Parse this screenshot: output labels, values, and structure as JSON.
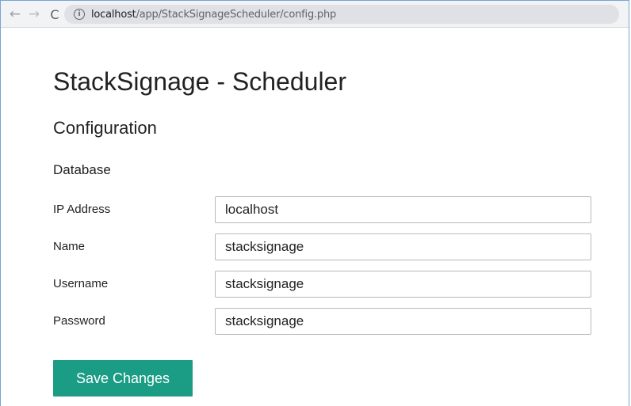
{
  "browser": {
    "back_glyph": "←",
    "forward_glyph": "→",
    "reload_glyph": "C",
    "url_host": "localhost",
    "url_path": "/app/StackSignageScheduler/config.php"
  },
  "page": {
    "title": "StackSignage - Scheduler",
    "section_title": "Configuration",
    "subsection_title": "Database"
  },
  "form": {
    "fields": [
      {
        "label": "IP Address",
        "value": "localhost"
      },
      {
        "label": "Name",
        "value": "stacksignage"
      },
      {
        "label": "Username",
        "value": "stacksignage"
      },
      {
        "label": "Password",
        "value": "stacksignage"
      }
    ],
    "save_label": "Save Changes"
  },
  "colors": {
    "accent": "#1b9c85",
    "window_border": "#7aa3d6"
  }
}
